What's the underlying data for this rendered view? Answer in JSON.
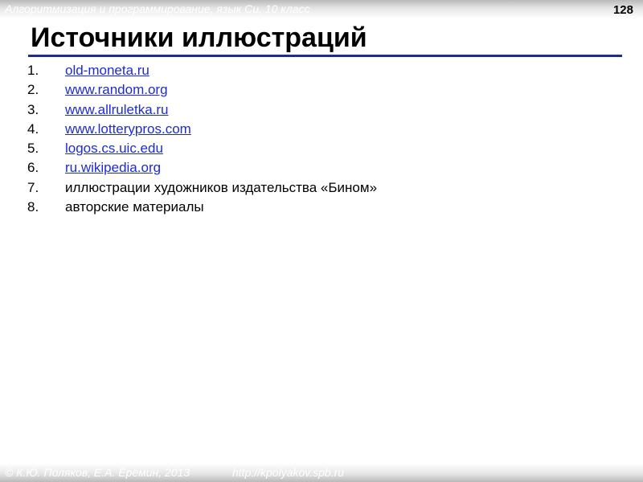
{
  "header": {
    "subtitle": "Алгоритмизация и программирование, язык Си, 10 класс",
    "page_number": "128"
  },
  "title": "Источники иллюстраций",
  "sources": [
    {
      "number": "1.",
      "text": "old-moneta.ru",
      "is_link": true
    },
    {
      "number": "2.",
      "text": "www.random.org",
      "is_link": true
    },
    {
      "number": "3.",
      "text": "www.allruletka.ru",
      "is_link": true
    },
    {
      "number": "4.",
      "text": "www.lotterypros.com",
      "is_link": true
    },
    {
      "number": "5.",
      "text": "logos.cs.uic.edu",
      "is_link": true
    },
    {
      "number": "6.",
      "text": "ru.wikipedia.org",
      "is_link": true
    },
    {
      "number": "7.",
      "text": "иллюстрации художников издательства «Бином»",
      "is_link": false
    },
    {
      "number": "8.",
      "text": "авторские материалы",
      "is_link": false
    }
  ],
  "footer": {
    "copyright": "© К.Ю. Поляков, Е.А. Ерёмин, 2013",
    "url": "http://kpolyakov.spb.ru"
  },
  "colors": {
    "link": "#1c2bd6",
    "title_rule": "#1f2e8a",
    "bar_gray": "#b9b9b9"
  }
}
